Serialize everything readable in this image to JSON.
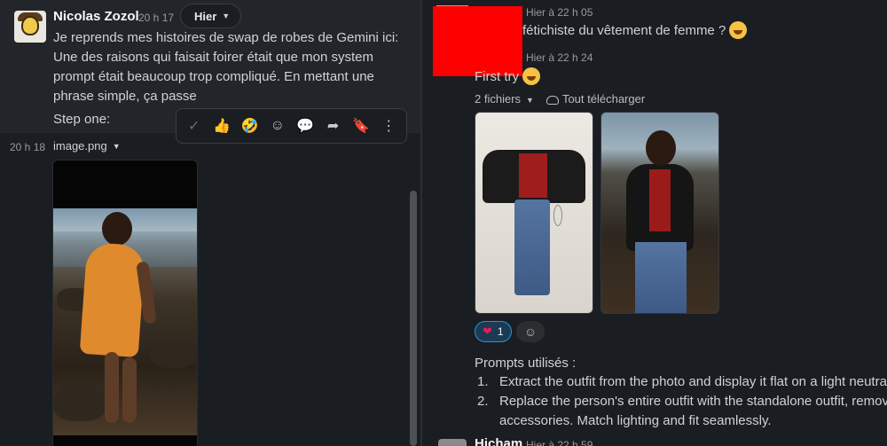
{
  "left_message": {
    "author": "Nicolas Zozol",
    "time": "20 h 17",
    "date_pill": "Hier",
    "text": "Je reprends mes histoires de swap de robes de Gemini ici: Une des raisons qui faisait foirer était que mon system prompt était beaucoup trop compliqué. En mettant une phrase simple, ça passe",
    "step": "Step one:",
    "file_time": "20 h 18",
    "file_name": "image.png"
  },
  "toolbar": {
    "icons": [
      "check-icon",
      "thumbs-up-icon",
      "grinning-emoji-icon",
      "add-reaction-icon",
      "reply-thread-icon",
      "share-icon",
      "bookmark-icon",
      "more-icon"
    ],
    "glyphs": [
      "✓",
      "👍",
      "🤣",
      "☺",
      "💬",
      "➦",
      "🔖",
      "⋮"
    ]
  },
  "right_messages": {
    "msg1_time": "Hier à 22 h 05",
    "msg1_text": "fétichiste du vêtement de femme ?",
    "msg2_time": "Hier à 22 h 24",
    "msg2_text": "First try",
    "files_count": "2 fichiers",
    "download_all": "Tout télécharger",
    "reaction_count": "1",
    "prompts_title": "Prompts utilisés :",
    "prompts": [
      {
        "num": "1.",
        "text": "Extract the outfit from the photo and display it flat on a light neutral"
      },
      {
        "num": "2.",
        "text": "Replace the person's entire outfit with the standalone outfit, removi\naccessories. Match lighting and fit seamlessly."
      }
    ],
    "next_author": "Hicham",
    "next_time": "Hier à 22 h 59"
  },
  "colors": {
    "background": "#1a1d21",
    "accent_blue": "#1d9bd1",
    "redaction": "#ff0000"
  }
}
